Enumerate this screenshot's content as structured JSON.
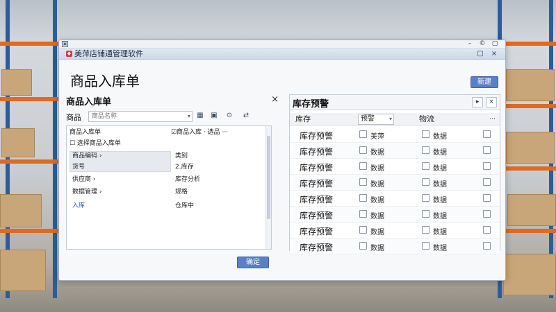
{
  "window": {
    "app_title": "美萍店铺通管理软件",
    "page_title": "商品入库单",
    "top_action_label": "新建"
  },
  "left_panel": {
    "header": "商品入库单",
    "close_glyph": "×",
    "search_label": "商品",
    "search_placeholder": "商品名称",
    "tools": [
      "▦",
      "▣",
      "⊙",
      "⇄"
    ],
    "tree_rows": [
      {
        "col1": "商品入库单",
        "col2": "☑商品入库 · 选品 ···"
      },
      {
        "col1": "☐ 选择商品入库单",
        "col2": ""
      },
      {
        "col1": "商品编码",
        "col2": "类别"
      },
      {
        "col1": "货号",
        "col2": "2.库存"
      },
      {
        "col1": "供应商",
        "col2": "库存分析"
      },
      {
        "col1": "数据管理",
        "col2": "规格"
      },
      {
        "col1": "入库",
        "col2": "仓库中"
      }
    ],
    "confirm_label": "确定"
  },
  "right_panel": {
    "header": "库存预警",
    "columns": [
      "库存",
      "预警",
      "物流"
    ],
    "dropdown_value": "预警",
    "more_glyph": "···",
    "rows": [
      {
        "label": "库存预警",
        "c2": "美萍",
        "c3": "数据"
      },
      {
        "label": "库存预警",
        "c2": "数据",
        "c3": "数据"
      },
      {
        "label": "库存预警",
        "c2": "数据",
        "c3": "数据"
      },
      {
        "label": "库存预警",
        "c2": "数据",
        "c3": "数据"
      },
      {
        "label": "库存预警",
        "c2": "数据",
        "c3": "数据"
      },
      {
        "label": "库存预警",
        "c2": "数据",
        "c3": "数据"
      },
      {
        "label": "库存预警",
        "c2": "数据",
        "c3": "数据"
      },
      {
        "label": "库存预警",
        "c2": "数据",
        "c3": "数据"
      }
    ]
  }
}
